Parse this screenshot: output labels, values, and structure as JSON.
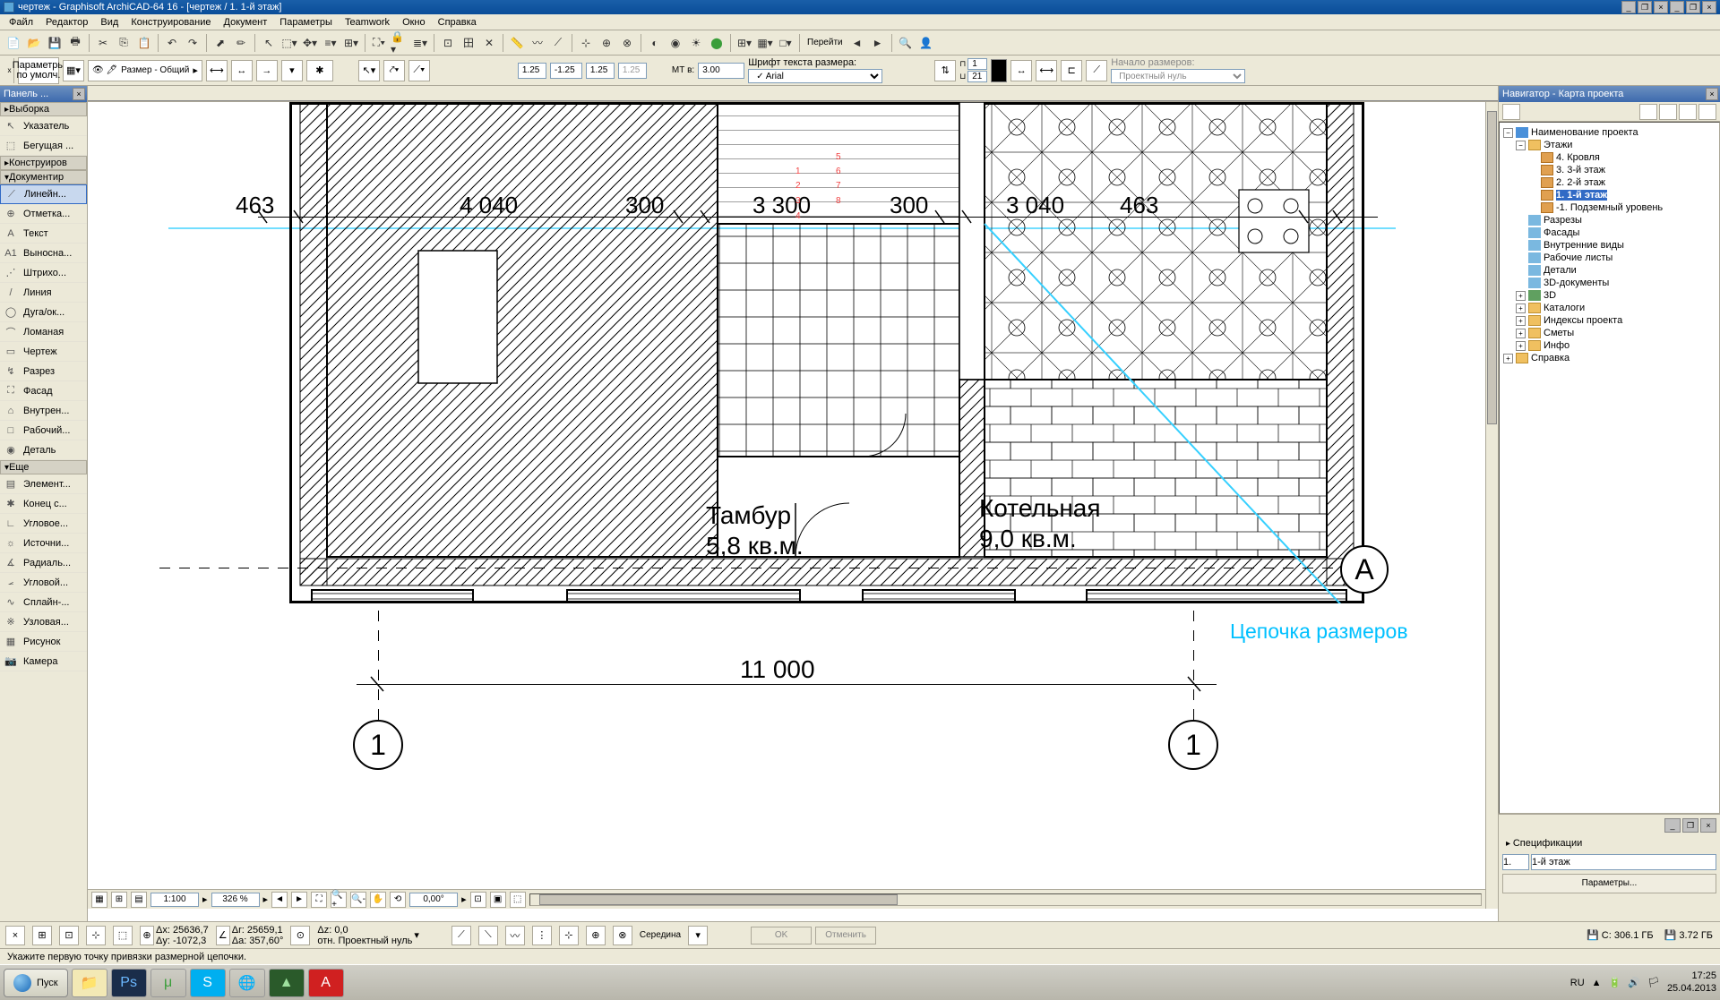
{
  "title": "чертеж - Graphisoft ArchiCAD-64 16 - [чертеж / 1. 1-й этаж]",
  "menu": [
    "Файл",
    "Редактор",
    "Вид",
    "Конструирование",
    "Документ",
    "Параметры",
    "Teamwork",
    "Окно",
    "Справка"
  ],
  "toolbar2": {
    "params_label": "Параметры по умолч.",
    "layer": "Размер - Общий",
    "d1": "1.25",
    "d2": "-1.25",
    "d3": "1.25",
    "d4": "1.25",
    "scale_label": "МТ в:",
    "scale_val": "3.00",
    "font_label": "Шрифт текста размера:",
    "font": "Arial",
    "num1": "1",
    "num2": "21",
    "origin_label": "Начало размеров:",
    "origin": "Проектный нуль",
    "goto": "Перейти"
  },
  "toolbox": {
    "title": "Панель ...",
    "groups": {
      "sel": "Выборка",
      "constr": "Конструиров",
      "doc": "Документир",
      "more": "Еще"
    },
    "tools": [
      {
        "ico": "↖",
        "txt": "Указатель"
      },
      {
        "ico": "⬚",
        "txt": "Бегущая ..."
      },
      {
        "ico": "⟋",
        "txt": "Линейн..."
      },
      {
        "ico": "⊕",
        "txt": "Отметка..."
      },
      {
        "ico": "A",
        "txt": "Текст"
      },
      {
        "ico": "A1",
        "txt": "Выносна..."
      },
      {
        "ico": "⋰",
        "txt": "Штрихо..."
      },
      {
        "ico": "/",
        "txt": "Линия"
      },
      {
        "ico": "◯",
        "txt": "Дуга/ок..."
      },
      {
        "ico": "⌒",
        "txt": "Ломаная"
      },
      {
        "ico": "▭",
        "txt": "Чертеж"
      },
      {
        "ico": "↯",
        "txt": "Разрез"
      },
      {
        "ico": "⛶",
        "txt": "Фасад"
      },
      {
        "ico": "⌂",
        "txt": "Внутрен..."
      },
      {
        "ico": "□",
        "txt": "Рабочий..."
      },
      {
        "ico": "◉",
        "txt": "Деталь"
      },
      {
        "ico": "▤",
        "txt": "Элемент..."
      },
      {
        "ico": "✱",
        "txt": "Конец с..."
      },
      {
        "ico": "∟",
        "txt": "Угловое..."
      },
      {
        "ico": "☼",
        "txt": "Источни..."
      },
      {
        "ico": "∡",
        "txt": "Радиаль..."
      },
      {
        "ico": "⦟",
        "txt": "Угловой..."
      },
      {
        "ico": "∿",
        "txt": "Сплайн-..."
      },
      {
        "ico": "※",
        "txt": "Узловая..."
      },
      {
        "ico": "▦",
        "txt": "Рисунок"
      },
      {
        "ico": "📷",
        "txt": "Камера"
      }
    ]
  },
  "drawing": {
    "dims": {
      "d463a": "463",
      "d4040": "4 040",
      "d300a": "300",
      "d3300": "3 300",
      "d300b": "300",
      "d3040": "3 040",
      "d463b": "463",
      "d11000": "11 000"
    },
    "rooms": {
      "tambur_name": "Тамбур",
      "tambur_area": "5,8 кв.м.",
      "kotel_name": "Котельная",
      "kotel_area": "9,0 кв.м."
    },
    "annotation": "Цепочка размеров",
    "axis_a": "А",
    "axis_1a": "1",
    "axis_1b": "1",
    "red_nums": [
      "1",
      "2",
      "3",
      "4",
      "5",
      "6",
      "7",
      "8"
    ]
  },
  "zoombar": {
    "scale": "1:100",
    "zoom": "326 %",
    "angle": "0,00°"
  },
  "coords": {
    "dx": "Δx: 25636,7",
    "dy": "Δy: -1072,3",
    "dr": "Δr: 25659,1",
    "da": "Δa: 357,60°",
    "dz": "Δz: 0,0",
    "origin": "отн. Проектный нуль",
    "snap": "Середина",
    "ok": "OK",
    "cancel": "Отменить"
  },
  "status": {
    "hint": "Укажите первую точку привязки размерной цепочки.",
    "disk_c": "C: 306.1 ГБ",
    "disk_d": "3.72 ГБ",
    "lang": "RU"
  },
  "navigator": {
    "title": "Навигатор - Карта проекта",
    "root": "Наименование проекта",
    "stories_grp": "Этажи",
    "stories": [
      "4. Кровля",
      "3. 3-й этаж",
      "2. 2-й этаж",
      "1. 1-й этаж",
      "-1. Подземный уровень"
    ],
    "items": [
      "Разрезы",
      "Фасады",
      "Внутренние виды",
      "Рабочие листы",
      "Детали",
      "3D-документы",
      "3D",
      "Каталоги",
      "Индексы проекта",
      "Сметы",
      "Инфо",
      "Справка"
    ],
    "spec": "Спецификации",
    "floor1": "1.",
    "floor_name": "1-й этаж",
    "params": "Параметры..."
  },
  "taskbar": {
    "start": "Пуск",
    "time": "17:25",
    "date": "25.04.2013"
  }
}
